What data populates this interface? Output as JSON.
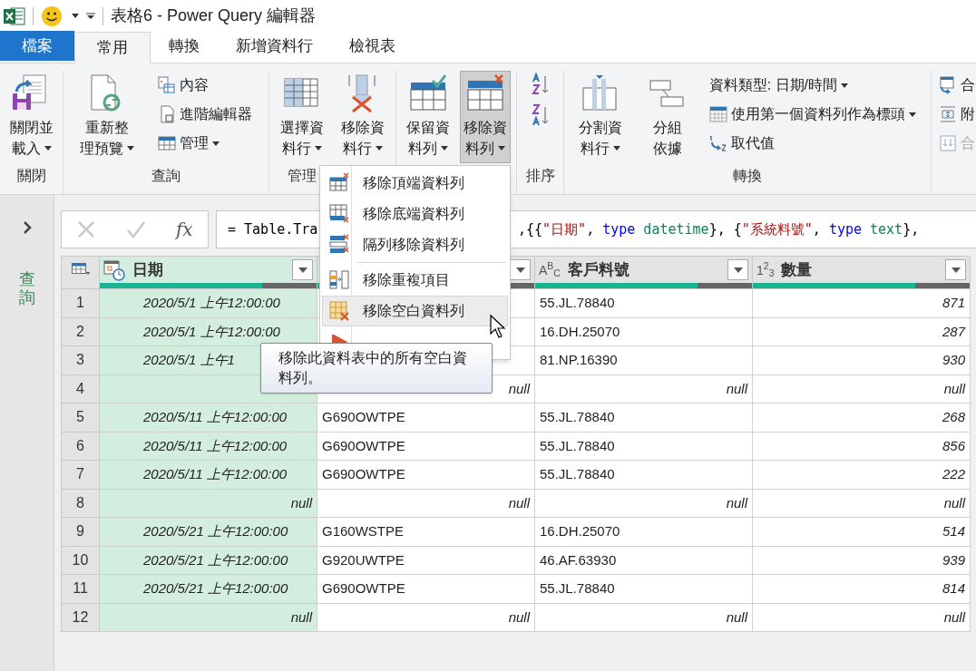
{
  "title_bar": {
    "title": "表格6 - Power Query 編輯器"
  },
  "tabs": [
    {
      "label": "檔案",
      "kind": "file",
      "selected": false
    },
    {
      "label": "常用",
      "kind": "tab",
      "selected": true
    },
    {
      "label": "轉換",
      "kind": "tab",
      "selected": false
    },
    {
      "label": "新增資料行",
      "kind": "tab",
      "selected": false
    },
    {
      "label": "檢視表",
      "kind": "tab",
      "selected": false
    }
  ],
  "ribbon": {
    "groups": [
      {
        "label": "關閉",
        "items": [
          {
            "kind": "large",
            "lines": [
              "關閉並",
              "載入"
            ],
            "dropdown": true,
            "pressed": false
          }
        ]
      },
      {
        "label": "查詢",
        "items": [
          {
            "kind": "large",
            "lines": [
              "重新整",
              "理預覽"
            ],
            "dropdown": true,
            "pressed": false
          },
          {
            "kind": "stack",
            "items": [
              {
                "label": "內容",
                "dropdown": false,
                "disabled": false
              },
              {
                "label": "進階編輯器",
                "dropdown": false,
                "disabled": false
              },
              {
                "label": "管理",
                "dropdown": true,
                "disabled": false
              }
            ]
          }
        ]
      },
      {
        "label": "管理",
        "items": [
          {
            "kind": "large",
            "lines": [
              "選擇資",
              "料行"
            ],
            "dropdown": true,
            "pressed": false
          },
          {
            "kind": "large",
            "lines": [
              "移除資",
              "料行"
            ],
            "dropdown": true,
            "pressed": false
          }
        ]
      },
      {
        "items": [
          {
            "kind": "large",
            "lines": [
              "保留資",
              "料列"
            ],
            "dropdown": true,
            "pressed": false
          },
          {
            "kind": "large",
            "lines": [
              "移除資",
              "料列"
            ],
            "dropdown": true,
            "pressed": true
          }
        ]
      },
      {
        "label": "排序",
        "items": [
          {
            "kind": "sort"
          }
        ]
      },
      {
        "label": "轉換",
        "items": [
          {
            "kind": "large",
            "lines": [
              "分割資",
              "料行"
            ],
            "dropdown": true,
            "pressed": false
          },
          {
            "kind": "large",
            "lines": [
              "分組",
              "依據"
            ],
            "dropdown": false,
            "pressed": false
          },
          {
            "kind": "stack",
            "items": [
              {
                "label": "資料類型: 日期/時間",
                "dropdown": true,
                "disabled": false
              },
              {
                "label": "使用第一個資料列作為標頭",
                "dropdown": true,
                "disabled": false
              },
              {
                "label": "取代值",
                "dropdown": false,
                "disabled": false
              }
            ]
          }
        ]
      },
      {
        "items": [
          {
            "kind": "stack",
            "items": [
              {
                "label": "合",
                "dropdown": false,
                "disabled": false
              },
              {
                "label": "附",
                "dropdown": false,
                "disabled": false
              },
              {
                "label": "合",
                "dropdown": false,
                "disabled": true
              }
            ]
          }
        ]
      }
    ]
  },
  "left_panel": {
    "label": "查詢"
  },
  "formula_bar": {
    "fx": "fx",
    "segments": [
      [
        {
          "text": "= Table.Tra",
          "color": "#000000"
        }
      ],
      [
        {
          "text": ",{{",
          "color": "#000000"
        },
        {
          "text": "\"日期\"",
          "color": "#a31515"
        },
        {
          "text": ", ",
          "color": "#000000"
        },
        {
          "text": "type",
          "color": "#0000ff"
        },
        {
          "text": " datetime",
          "color": "#098658"
        },
        {
          "text": "}, {",
          "color": "#000000"
        },
        {
          "text": "\"系統料號\"",
          "color": "#a31515"
        },
        {
          "text": ", ",
          "color": "#000000"
        },
        {
          "text": "type",
          "color": "#0000ff"
        },
        {
          "text": " text",
          "color": "#098658"
        },
        {
          "text": "},",
          "color": "#000000"
        }
      ]
    ]
  },
  "table": {
    "columns": [
      {
        "name": "日期",
        "kind": "datetime",
        "selected": true,
        "level": 0.75
      },
      {
        "kind": "text",
        "selected": false,
        "level": 0.75
      },
      {
        "name": "客戶料號",
        "kind": "text",
        "type_label": "A$^{B}$$_{C}$",
        "selected": false,
        "level": 0.75
      },
      {
        "name": "數量",
        "kind": "number",
        "type_label": "1$^{2}$$_{3}$",
        "selected": false,
        "level": 0.75
      }
    ],
    "rows": [
      {
        "number": "1",
        "cells": [
          {
            "text": "2020/5/1 上午12:00:00",
            "kind": "value"
          },
          null,
          {
            "text": "55.JL.78840",
            "kind": "value"
          },
          {
            "text": "871",
            "kind": "value"
          }
        ]
      },
      {
        "number": "2",
        "cells": [
          {
            "text": "2020/5/1 上午12:00:00",
            "kind": "value"
          },
          null,
          {
            "text": "16.DH.25070",
            "kind": "value"
          },
          {
            "text": "287",
            "kind": "value"
          }
        ]
      },
      {
        "number": "3",
        "cells": [
          {
            "text": "2020/5/1 上午1",
            "kind": "value"
          },
          null,
          {
            "text": "81.NP.16390",
            "kind": "value"
          },
          {
            "text": "930",
            "kind": "value"
          }
        ]
      },
      {
        "number": "4",
        "cells": [
          null,
          {
            "text": "null",
            "kind": "null"
          },
          {
            "text": "null",
            "kind": "null"
          },
          {
            "text": "null",
            "kind": "null"
          }
        ]
      },
      {
        "number": "5",
        "cells": [
          {
            "text": "2020/5/11 上午12:00:00",
            "kind": "value"
          },
          {
            "text": "G690OWTPE",
            "kind": "value"
          },
          {
            "text": "55.JL.78840",
            "kind": "value"
          },
          {
            "text": "268",
            "kind": "value"
          }
        ]
      },
      {
        "number": "6",
        "cells": [
          {
            "text": "2020/5/11 上午12:00:00",
            "kind": "value"
          },
          {
            "text": "G690OWTPE",
            "kind": "value"
          },
          {
            "text": "55.JL.78840",
            "kind": "value"
          },
          {
            "text": "856",
            "kind": "value"
          }
        ]
      },
      {
        "number": "7",
        "cells": [
          {
            "text": "2020/5/11 上午12:00:00",
            "kind": "value"
          },
          {
            "text": "G690OWTPE",
            "kind": "value"
          },
          {
            "text": "55.JL.78840",
            "kind": "value"
          },
          {
            "text": "222",
            "kind": "value"
          }
        ]
      },
      {
        "number": "8",
        "cells": [
          {
            "text": "null",
            "kind": "null"
          },
          {
            "text": "null",
            "kind": "null"
          },
          {
            "text": "null",
            "kind": "null"
          },
          {
            "text": "null",
            "kind": "null"
          }
        ]
      },
      {
        "number": "9",
        "cells": [
          {
            "text": "2020/5/21 上午12:00:00",
            "kind": "value"
          },
          {
            "text": "G160WSTPE",
            "kind": "value"
          },
          {
            "text": "16.DH.25070",
            "kind": "value"
          },
          {
            "text": "514",
            "kind": "value"
          }
        ]
      },
      {
        "number": "10",
        "cells": [
          {
            "text": "2020/5/21 上午12:00:00",
            "kind": "value"
          },
          {
            "text": "G920UWTPE",
            "kind": "value"
          },
          {
            "text": "46.AF.63930",
            "kind": "value"
          },
          {
            "text": "939",
            "kind": "value"
          }
        ]
      },
      {
        "number": "11",
        "cells": [
          {
            "text": "2020/5/21 上午12:00:00",
            "kind": "value"
          },
          {
            "text": "G690OWTPE",
            "kind": "value"
          },
          {
            "text": "55.JL.78840",
            "kind": "value"
          },
          {
            "text": "814",
            "kind": "value"
          }
        ]
      },
      {
        "number": "12",
        "cells": [
          {
            "text": "null",
            "kind": "null"
          },
          {
            "text": "null",
            "kind": "null"
          },
          {
            "text": "null",
            "kind": "null"
          },
          {
            "text": "null",
            "kind": "null"
          }
        ]
      }
    ]
  },
  "menu": {
    "items": [
      {
        "kind": "item",
        "label": "移除頂端資料列",
        "selected": false
      },
      {
        "kind": "item",
        "label": "移除底端資料列",
        "selected": false
      },
      {
        "kind": "item",
        "label": "隔列移除資料列",
        "selected": false
      },
      {
        "kind": "separator"
      },
      {
        "kind": "item",
        "label": "移除重複項目",
        "selected": false
      },
      {
        "kind": "item",
        "label": "移除空白資料列",
        "selected": true
      },
      {
        "kind": "item",
        "selected": false
      }
    ]
  },
  "tooltip": {
    "text": "移除此資料表中的所有空白資料列。"
  }
}
